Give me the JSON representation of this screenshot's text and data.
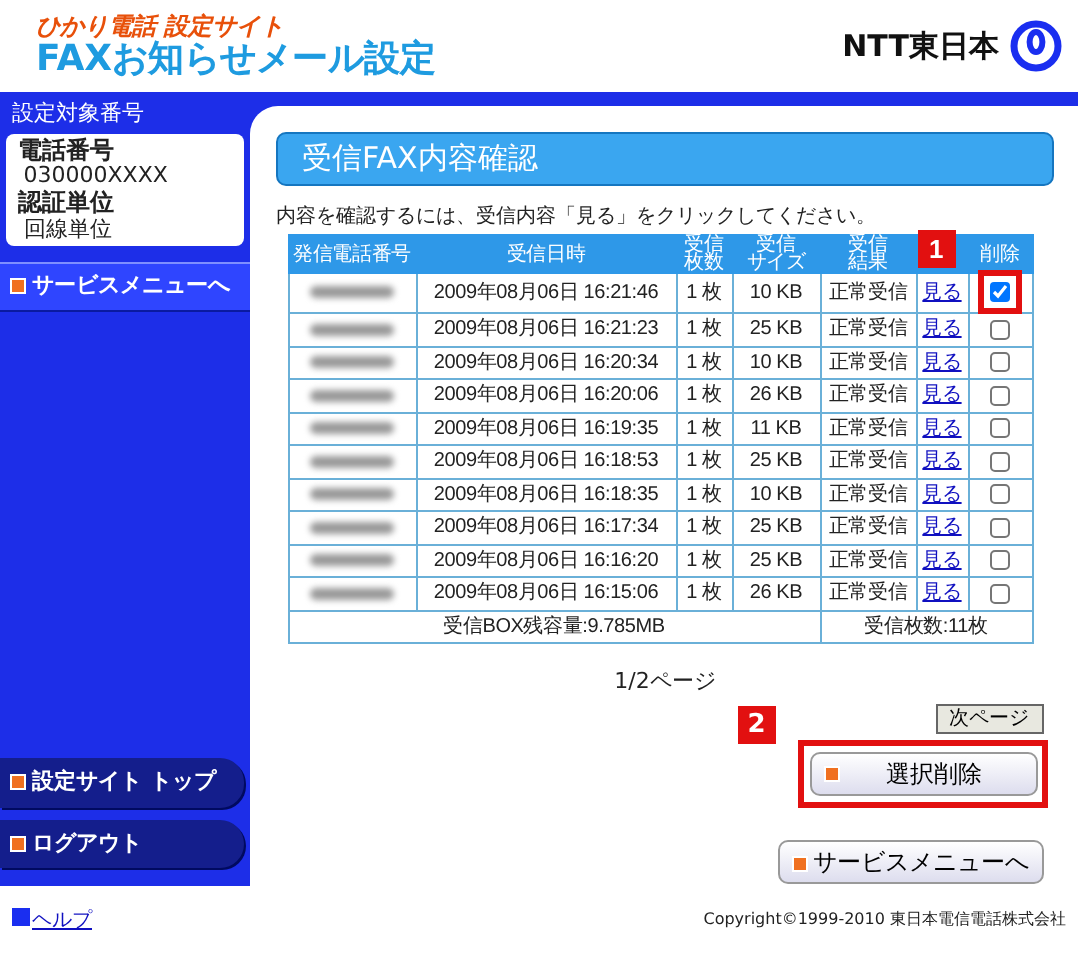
{
  "header": {
    "subtitle": "ひかり電話 設定サイト",
    "title": "FAXお知らせメール設定",
    "logo_text": "NTT東日本"
  },
  "sidebar": {
    "section_label": "設定対象番号",
    "fields": [
      {
        "label": "電話番号",
        "value": "030000XXXX"
      },
      {
        "label": "認証単位",
        "value": "回線単位"
      }
    ],
    "menu_button": "サービスメニューへ",
    "bottom_items": [
      "設定サイト トップ",
      "ログアウト"
    ]
  },
  "main": {
    "title": "受信FAX内容確認",
    "instruction": "内容を確認するには、受信内容「見る」をクリックしてください。",
    "table": {
      "columns": [
        [
          "発信電話番号"
        ],
        [
          "受信日時"
        ],
        [
          "受信",
          "枚数"
        ],
        [
          "受信",
          "サイズ"
        ],
        [
          "受信",
          "結果"
        ],
        [],
        [
          "削除"
        ]
      ],
      "rows": [
        {
          "time": "2009年08月06日 16:21:46",
          "pages": "1 枚",
          "size": "10 KB",
          "result": "正常受信",
          "view": "見る",
          "delete_checked": true
        },
        {
          "time": "2009年08月06日 16:21:23",
          "pages": "1 枚",
          "size": "25 KB",
          "result": "正常受信",
          "view": "見る",
          "delete_checked": false
        },
        {
          "time": "2009年08月06日 16:20:34",
          "pages": "1 枚",
          "size": "10 KB",
          "result": "正常受信",
          "view": "見る",
          "delete_checked": false
        },
        {
          "time": "2009年08月06日 16:20:06",
          "pages": "1 枚",
          "size": "26 KB",
          "result": "正常受信",
          "view": "見る",
          "delete_checked": false
        },
        {
          "time": "2009年08月06日 16:19:35",
          "pages": "1 枚",
          "size": "11 KB",
          "result": "正常受信",
          "view": "見る",
          "delete_checked": false
        },
        {
          "time": "2009年08月06日 16:18:53",
          "pages": "1 枚",
          "size": "25 KB",
          "result": "正常受信",
          "view": "見る",
          "delete_checked": false
        },
        {
          "time": "2009年08月06日 16:18:35",
          "pages": "1 枚",
          "size": "10 KB",
          "result": "正常受信",
          "view": "見る",
          "delete_checked": false
        },
        {
          "time": "2009年08月06日 16:17:34",
          "pages": "1 枚",
          "size": "25 KB",
          "result": "正常受信",
          "view": "見る",
          "delete_checked": false
        },
        {
          "time": "2009年08月06日 16:16:20",
          "pages": "1 枚",
          "size": "25 KB",
          "result": "正常受信",
          "view": "見る",
          "delete_checked": false
        },
        {
          "time": "2009年08月06日 16:15:06",
          "pages": "1 枚",
          "size": "26 KB",
          "result": "正常受信",
          "view": "見る",
          "delete_checked": false
        }
      ],
      "capacity": "受信BOX残容量:9.785MB",
      "count": "受信枚数:11枚"
    },
    "page_indicator": "1/2ページ",
    "next_button": "次ページ",
    "delete_button": "選択削除",
    "service_button": "サービスメニューへ"
  },
  "annotations": [
    {
      "kind": "checkbox",
      "number": "1"
    },
    {
      "kind": "delete_button",
      "number": "2"
    }
  ],
  "footer": {
    "help_link": "ヘルプ",
    "copyright": "Copyright©1999-2010 東日本電信電話株式会社"
  }
}
